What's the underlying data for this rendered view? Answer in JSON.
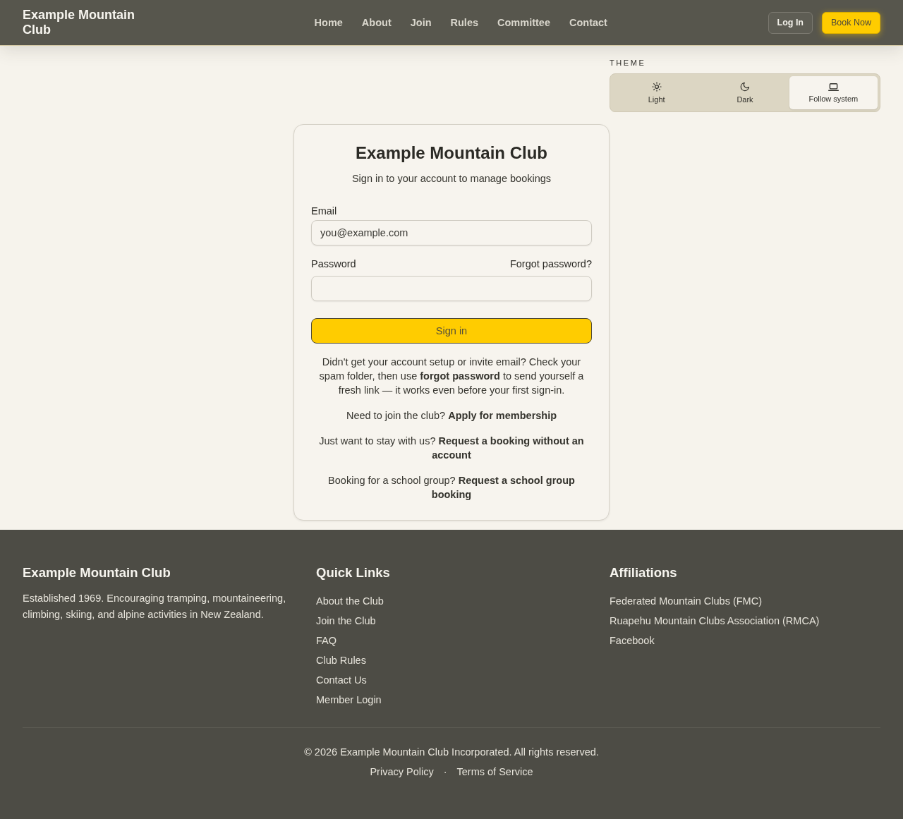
{
  "header": {
    "brand": "Example Mountain Club",
    "nav": [
      "Home",
      "About",
      "Join",
      "Rules",
      "Committee",
      "Contact"
    ],
    "buttons": [
      {
        "label": "Log In",
        "kind": "outline"
      },
      {
        "label": "Book Now",
        "kind": "primary"
      }
    ]
  },
  "theme": {
    "label": "THEME",
    "options": [
      {
        "label": "Light",
        "selected": false
      },
      {
        "label": "Dark",
        "selected": false
      },
      {
        "label": "Follow system",
        "selected": true
      }
    ]
  },
  "login": {
    "title": "Example Mountain Club",
    "subtitle": "Sign in to your account to manage bookings",
    "email": {
      "label": "Email",
      "placeholder": "you@example.com"
    },
    "password": {
      "label": "Password",
      "link": "Forgot password?"
    },
    "submit": "Sign in",
    "help": [
      "Didn't get your account setup or invite email? Check your spam folder, then use **forgot password** to send yourself a fresh link — it works even before your first sign-in.",
      "Need to join the club? **Apply for membership**",
      "Just want to stay with us? **Request a booking without an account**",
      "Booking for a school group? **Request a school group booking**"
    ]
  },
  "footer": {
    "brand": {
      "title": "Example Mountain Club",
      "text": "Established 1969. Encouraging tramping, mountaineering, climbing, skiing, and alpine activities in New Zealand."
    },
    "columns": [
      {
        "title": "Quick Links",
        "links": [
          "About the Club",
          "Join the Club",
          "FAQ",
          "Club Rules",
          "Contact Us",
          "Member Login"
        ]
      },
      {
        "title": "Affiliations",
        "links": [
          "Federated Mountain Clubs (FMC)",
          "Ruapehu Mountain Clubs Association (RMCA)",
          "Facebook"
        ]
      }
    ],
    "copyright": "© 2026 Example Mountain Club Incorporated. All rights reserved.",
    "legal_links": [
      "Privacy Policy",
      "Terms of Service"
    ],
    "separator": "·"
  }
}
